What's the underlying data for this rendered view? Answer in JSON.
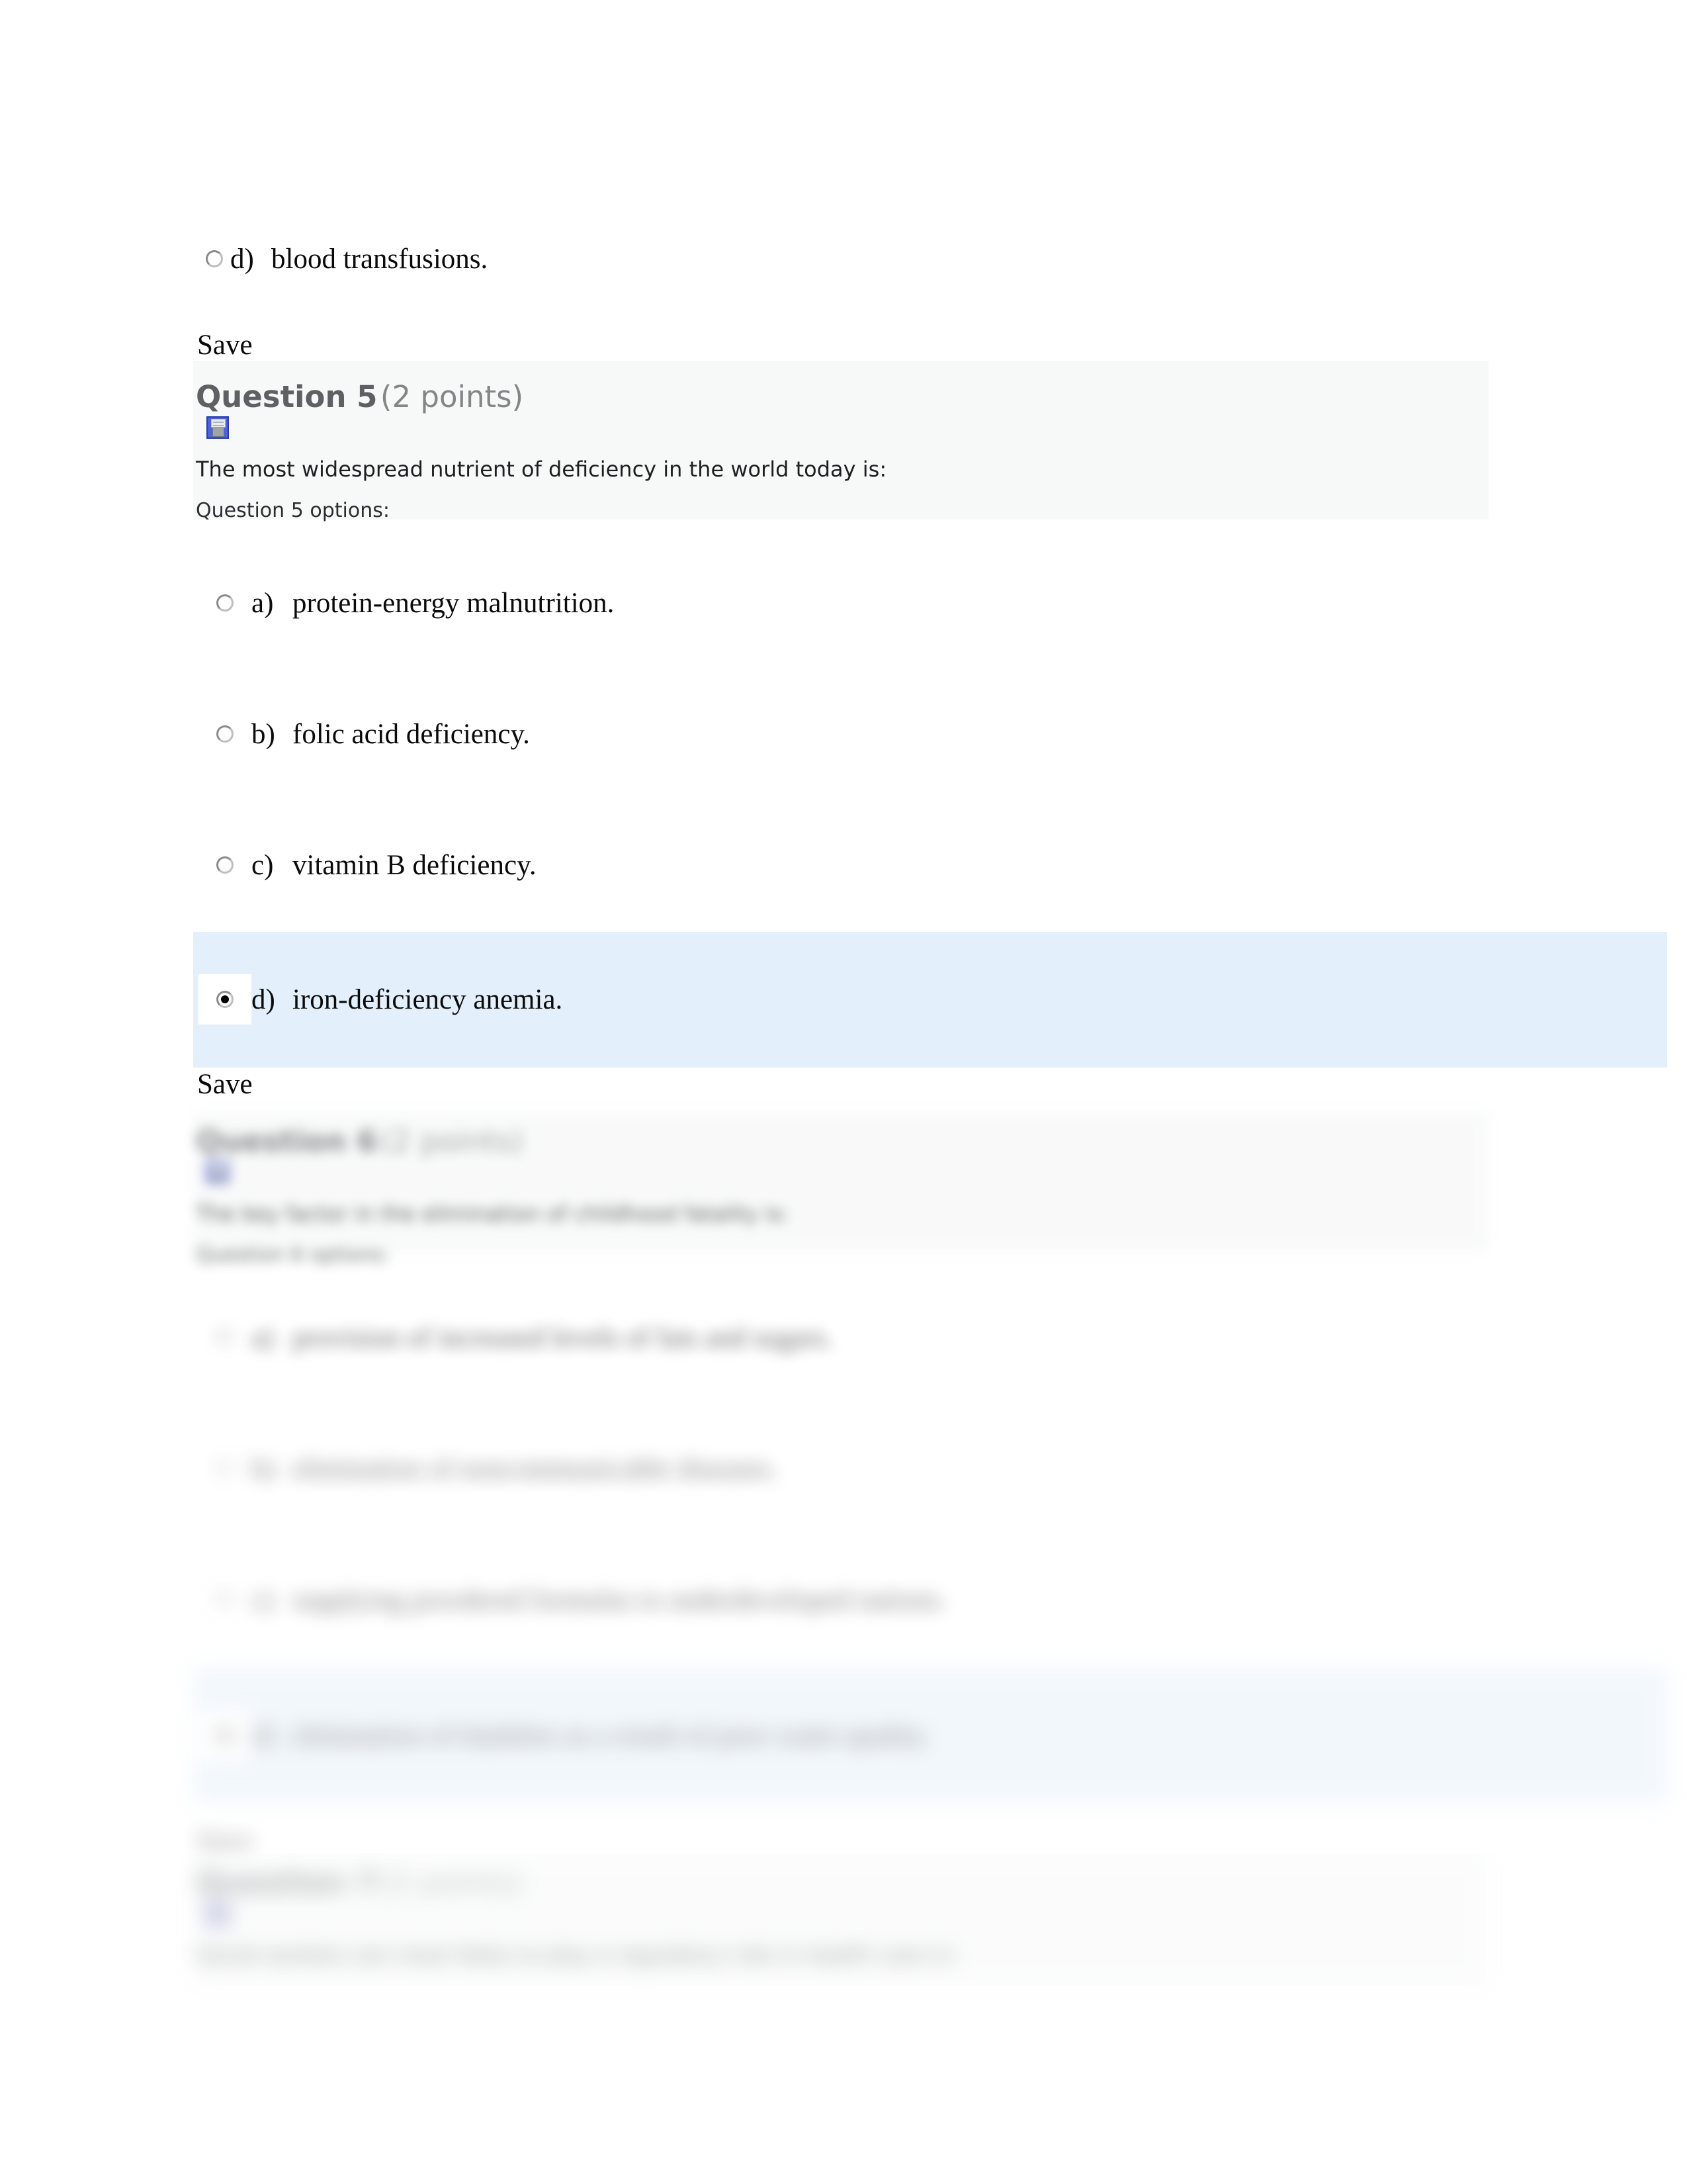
{
  "page": {
    "background": "#ffffff",
    "highlight_color": "#e3effa",
    "question_box_color": "#f7f8f8",
    "heading_color": "#5d6163",
    "points_color": "#818687",
    "body_text_color": "#1d2021"
  },
  "previous_question_tail": {
    "option": {
      "letter": "d)",
      "text": "blood transfusions.",
      "selected": false
    },
    "save_label": "Save"
  },
  "question5": {
    "number_label": "Question 5",
    "points_label": "(2 points)",
    "save_icon_name": "floppy-disk-icon",
    "prompt": "The most widespread nutrient of deficiency in the world today is:",
    "options_label": "Question 5 options:",
    "options": [
      {
        "letter": "a)",
        "text": "protein-energy malnutrition.",
        "selected": false
      },
      {
        "letter": "b)",
        "text": "folic acid deficiency.",
        "selected": false
      },
      {
        "letter": "c)",
        "text": "vitamin B deficiency.",
        "selected": false
      },
      {
        "letter": "d)",
        "text": "iron-deficiency anemia.",
        "selected": true
      }
    ],
    "save_label": "Save"
  },
  "question6": {
    "number_label": "Question 6",
    "points_label": "(2 points)",
    "save_icon_name": "floppy-disk-icon",
    "prompt": "The key factor in the elimination of childhood fatality is:",
    "options_label": "Question 6 options:",
    "options": [
      {
        "letter": "a)",
        "text": "provision of increased levels of fats and sugars.",
        "selected": false
      },
      {
        "letter": "b)",
        "text": "elimination of noncommunicable diseases.",
        "selected": false
      },
      {
        "letter": "c)",
        "text": "supplying powdered formulas to underdeveloped nations.",
        "selected": false
      },
      {
        "letter": "d)",
        "text": "elimination of fatalities as a result of poor water quality.",
        "selected": true
      }
    ],
    "save_label": "Save"
  },
  "question7": {
    "number_label": "Question 7",
    "points_label": "(2 points)",
    "save_icon_name": "floppy-disk-icon",
    "prompt": "Social workers are most likely to play a regulatory role in health care in:"
  }
}
